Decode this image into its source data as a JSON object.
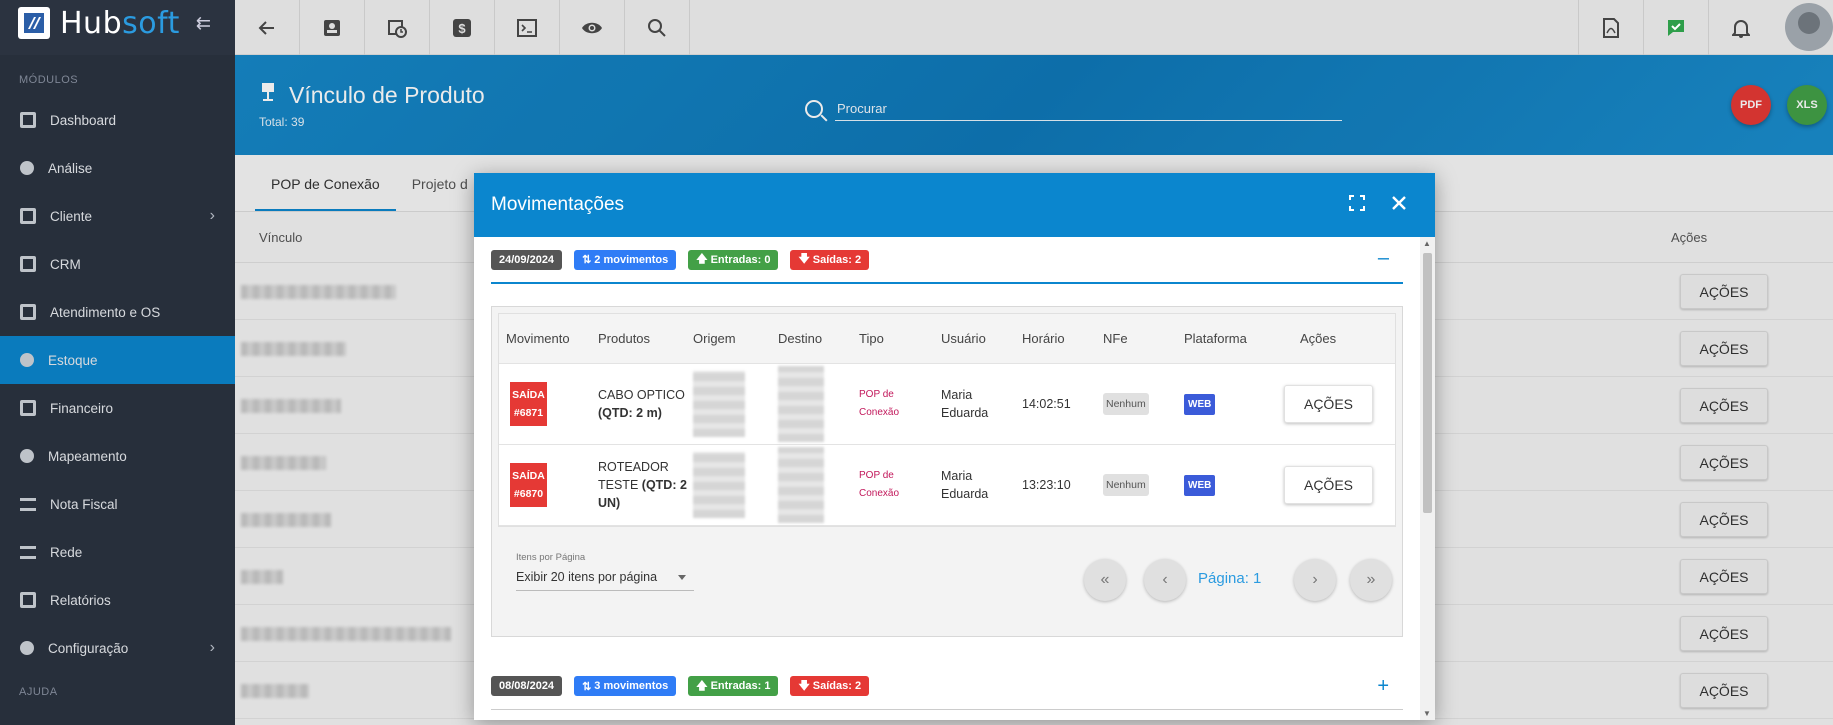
{
  "brand": {
    "name_a": "Hub",
    "name_b": "soft"
  },
  "sidebar": {
    "section_modules": "MÓDULOS",
    "section_help": "AJUDA",
    "items": [
      {
        "label": "Dashboard",
        "icon": "dashboard-icon"
      },
      {
        "label": "Análise",
        "icon": "chart-pie-icon"
      },
      {
        "label": "Cliente",
        "icon": "person-card-icon",
        "expandable": true
      },
      {
        "label": "CRM",
        "icon": "crm-icon"
      },
      {
        "label": "Atendimento e OS",
        "icon": "calendar-clock-icon"
      },
      {
        "label": "Estoque",
        "icon": "cube-icon",
        "active": true
      },
      {
        "label": "Financeiro",
        "icon": "money-icon"
      },
      {
        "label": "Mapeamento",
        "icon": "map-pin-icon"
      },
      {
        "label": "Nota Fiscal",
        "icon": "document-icon"
      },
      {
        "label": "Rede",
        "icon": "network-icon"
      },
      {
        "label": "Relatórios",
        "icon": "report-icon"
      },
      {
        "label": "Configuração",
        "icon": "gear-icon",
        "expandable": true
      }
    ]
  },
  "topbar": {
    "left_icons": [
      "back-arrow-icon",
      "contact-card-icon",
      "calendar-clock-icon",
      "dollar-icon",
      "terminal-icon",
      "eye-icon",
      "search-icon"
    ],
    "right_icons": [
      "pdf-file-icon",
      "check-message-icon",
      "bell-icon",
      "avatar"
    ]
  },
  "header": {
    "title": "Vínculo de Produto",
    "total": "Total: 39",
    "search_placeholder": "Procurar",
    "pdf_fab": "PDF",
    "xls_fab": "XLS"
  },
  "tabs": [
    "POP de Conexão",
    "Projeto d"
  ],
  "list": {
    "col_vinculo": "Vínculo",
    "col_acoes": "Ações",
    "row_button": "AÇÕES"
  },
  "modal": {
    "title": "Movimentações",
    "groups": [
      {
        "date": "24/09/2024",
        "movimentos": "2 movimentos",
        "entradas": "Entradas: 0",
        "saidas": "Saídas: 2",
        "toggle": "–"
      },
      {
        "date": "08/08/2024",
        "movimentos": "3 movimentos",
        "entradas": "Entradas: 1",
        "saidas": "Saídas: 2",
        "toggle": "+"
      }
    ],
    "table": {
      "headers": [
        "Movimento",
        "Produtos",
        "Origem",
        "Destino",
        "Tipo",
        "Usuário",
        "Horário",
        "NFe",
        "Plataforma",
        "Ações"
      ],
      "rows": [
        {
          "mov_a": "SAÍDA",
          "mov_b": "#6871",
          "prod_a": "CABO OPTICO",
          "prod_b": "(QTD: 2 m)",
          "tipo_a": "POP de",
          "tipo_b": "Conexão",
          "usuario": "Maria Eduarda",
          "horario": "14:02:51",
          "nfe": "Nenhum",
          "plataforma": "WEB",
          "acao": "AÇÕES"
        },
        {
          "mov_a": "SAÍDA",
          "mov_b": "#6870",
          "prod_a": "ROTEADOR TESTE",
          "prod_b": "(QTD: 2 UN)",
          "tipo_a": "POP de",
          "tipo_b": "Conexão",
          "usuario": "Maria Eduarda",
          "horario": "13:23:10",
          "nfe": "Nenhum",
          "plataforma": "WEB",
          "acao": "AÇÕES"
        }
      ]
    },
    "pager": {
      "items_label": "Itens por Página",
      "items_value": "Exibir 20 itens por página",
      "page_label": "Página: 1"
    }
  },
  "colors": {
    "sidebar_bg": "#2b3340",
    "accent": "#0b86ce",
    "danger": "#e53935",
    "success": "#43a047",
    "info": "#2f7cf6"
  }
}
